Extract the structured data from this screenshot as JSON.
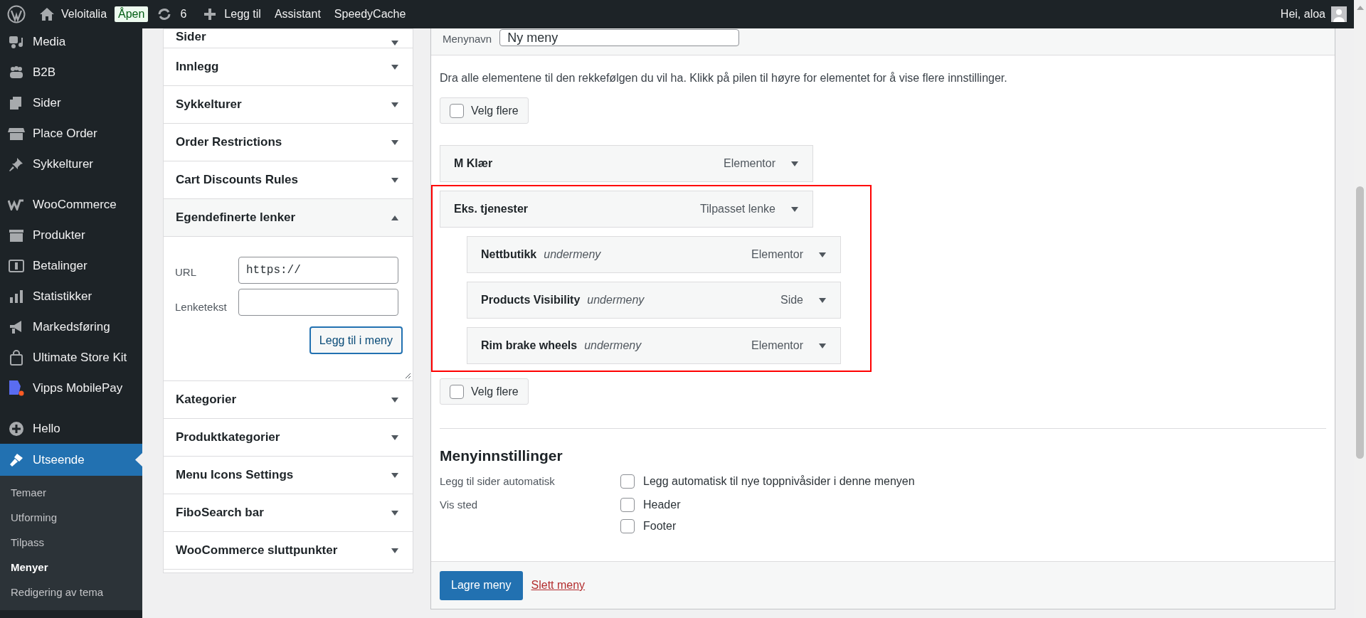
{
  "admin_bar": {
    "site": "Veloitalia",
    "badge": "Åpen",
    "updates": "6",
    "new": "Legg til",
    "links": [
      "Assistant",
      "SpeedyCache"
    ],
    "greeting": "Hei, aloa"
  },
  "sidebar": {
    "groups": [
      {
        "items": [
          {
            "label": "Media",
            "selected": false
          },
          {
            "label": "B2B",
            "selected": false
          },
          {
            "label": "Sider",
            "selected": false
          },
          {
            "label": "Place Order",
            "selected": false
          },
          {
            "label": "Sykkelturer",
            "selected": false
          }
        ]
      },
      {
        "items": [
          {
            "label": "WooCommerce",
            "selected": false
          },
          {
            "label": "Produkter",
            "selected": false
          },
          {
            "label": "Betalinger",
            "selected": false
          },
          {
            "label": "Statistikker",
            "selected": false
          },
          {
            "label": "Markedsføring",
            "selected": false
          },
          {
            "label": "Ultimate Store Kit",
            "selected": false
          },
          {
            "label": "Vipps MobilePay",
            "selected": false
          }
        ]
      },
      {
        "items": [
          {
            "label": "Hello",
            "selected": false
          },
          {
            "label": "Utseende",
            "selected": true,
            "children": [
              {
                "label": "Temaer",
                "selected": false
              },
              {
                "label": "Utforming",
                "selected": false
              },
              {
                "label": "Tilpass",
                "selected": false
              },
              {
                "label": "Menyer",
                "selected": true
              },
              {
                "label": "Redigering av tema",
                "selected": false
              }
            ]
          }
        ]
      }
    ]
  },
  "accordion": [
    {
      "title": "Sider",
      "expanded": false
    },
    {
      "title": "Innlegg",
      "expanded": false
    },
    {
      "title": "Sykkelturer",
      "expanded": false
    },
    {
      "title": "Order Restrictions",
      "expanded": false
    },
    {
      "title": "Cart Discounts Rules",
      "expanded": false
    },
    {
      "title": "Egendefinerte lenker",
      "expanded": true,
      "url_label": "URL",
      "url_value": "https://",
      "text_label": "Lenketekst",
      "button": "Legg til i meny"
    },
    {
      "title": "Kategorier",
      "expanded": false
    },
    {
      "title": "Produktkategorier",
      "expanded": false
    },
    {
      "title": "Menu Icons Settings",
      "expanded": false
    },
    {
      "title": "FiboSearch bar",
      "expanded": false
    },
    {
      "title": "WooCommerce sluttpunkter",
      "expanded": false
    }
  ],
  "menu_editor": {
    "name_label": "Menynavn",
    "name_value": "Ny meny",
    "instructions": "Dra alle elementene til den rekkefølgen du vil ha. Klikk på pilen til høyre for elementet for å vise flere innstillinger.",
    "select_top": {
      "label": "Velg flere",
      "checked": false
    },
    "items": [
      {
        "title": "M Klær",
        "type": "Elementor",
        "highlighted": false
      },
      {
        "title": "Eks. tjenester",
        "type": "Tilpasset lenke",
        "highlighted": true,
        "children": [
          {
            "title": "Nettbutikk",
            "sublabel": "undermeny",
            "type": "Elementor"
          },
          {
            "title": "Products Visibility",
            "sublabel": "undermeny",
            "type": "Side"
          },
          {
            "title": "Rim brake wheels",
            "sublabel": "undermeny",
            "type": "Elementor"
          }
        ]
      }
    ],
    "select_bottom": {
      "label": "Velg flere",
      "checked": false
    },
    "settings": {
      "heading": "Menyinnstillinger",
      "rows": [
        {
          "label": "Legg til sider automatisk",
          "options": [
            {
              "label": "Legg automatisk til nye toppnivåsider i denne menyen",
              "checked": false
            }
          ]
        },
        {
          "label": "Vis sted",
          "options": [
            {
              "label": "Header",
              "checked": false
            },
            {
              "label": "Footer",
              "checked": false
            }
          ]
        }
      ]
    },
    "save_button": "Lagre meny",
    "delete_link": "Slett meny"
  }
}
